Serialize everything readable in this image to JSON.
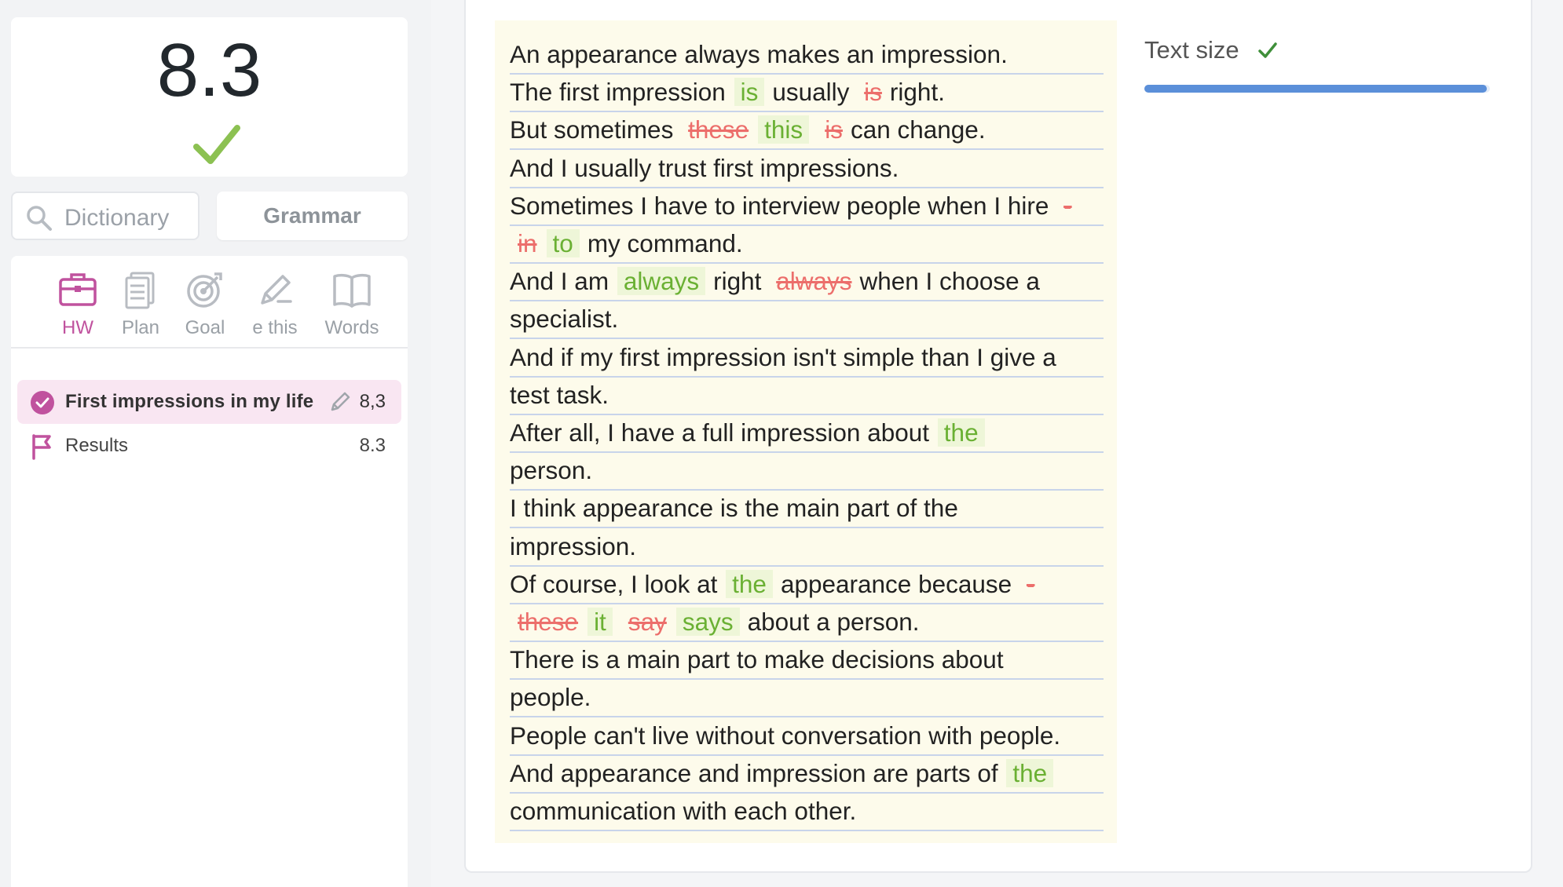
{
  "score": {
    "value": "8.3"
  },
  "search": {
    "dictionary_label": "Dictionary",
    "grammar_label": "Grammar"
  },
  "tabs": [
    {
      "label": "HW",
      "icon": "briefcase-icon",
      "active": true
    },
    {
      "label": "Plan",
      "icon": "document-icon",
      "active": false
    },
    {
      "label": "Goal",
      "icon": "target-icon",
      "active": false
    },
    {
      "label": "e this",
      "icon": "pencil-icon",
      "active": false
    },
    {
      "label": "Words",
      "icon": "book-icon",
      "active": false
    }
  ],
  "lessons": [
    {
      "title": "First impressions in my life",
      "score": "8,3",
      "active": true,
      "icon": "check-circle-icon"
    },
    {
      "title": "Results",
      "score": "8.3",
      "active": false,
      "icon": "flag-icon"
    }
  ],
  "essay": {
    "lines": [
      [
        {
          "t": "n",
          "v": "An appearance always makes an impression."
        }
      ],
      [
        {
          "t": "n",
          "v": "The first impression"
        },
        {
          "t": "ins",
          "v": "is"
        },
        {
          "t": "n",
          "v": "usually"
        },
        {
          "t": "del",
          "v": "is"
        },
        {
          "t": "n",
          "v": "right."
        }
      ],
      [
        {
          "t": "n",
          "v": "But sometimes"
        },
        {
          "t": "del",
          "v": "these"
        },
        {
          "t": "ins",
          "v": "this"
        },
        {
          "t": "del",
          "v": "is"
        },
        {
          "t": "n",
          "v": "can change."
        }
      ],
      [
        {
          "t": "n",
          "v": "And I usually trust first impressions."
        }
      ],
      [
        {
          "t": "n",
          "v": "Sometimes I have to interview people when I hire"
        },
        {
          "t": "del",
          "v": "-"
        }
      ],
      [
        {
          "t": "del",
          "v": "in"
        },
        {
          "t": "ins",
          "v": "to"
        },
        {
          "t": "n",
          "v": "my command."
        }
      ],
      [
        {
          "t": "n",
          "v": "And I am"
        },
        {
          "t": "ins",
          "v": "always"
        },
        {
          "t": "n",
          "v": "right"
        },
        {
          "t": "del",
          "v": "always"
        },
        {
          "t": "n",
          "v": "when I choose a"
        }
      ],
      [
        {
          "t": "n",
          "v": "specialist."
        }
      ],
      [
        {
          "t": "n",
          "v": "And if my first impression isn't simple than I give a"
        }
      ],
      [
        {
          "t": "n",
          "v": "test task."
        }
      ],
      [
        {
          "t": "n",
          "v": "After all, I have a full impression about"
        },
        {
          "t": "ins",
          "v": "the"
        }
      ],
      [
        {
          "t": "n",
          "v": "person."
        }
      ],
      [
        {
          "t": "n",
          "v": "I think appearance is the main part of the"
        }
      ],
      [
        {
          "t": "n",
          "v": "impression."
        }
      ],
      [
        {
          "t": "n",
          "v": "Of course, I look at"
        },
        {
          "t": "ins",
          "v": "the"
        },
        {
          "t": "n",
          "v": "appearance because"
        },
        {
          "t": "del",
          "v": "-"
        }
      ],
      [
        {
          "t": "del",
          "v": "these"
        },
        {
          "t": "ins",
          "v": "it"
        },
        {
          "t": "del",
          "v": "say"
        },
        {
          "t": "ins",
          "v": "says"
        },
        {
          "t": "n",
          "v": "about a person."
        }
      ],
      [
        {
          "t": "n",
          "v": "There is a main part to make decisions about"
        }
      ],
      [
        {
          "t": "n",
          "v": "people."
        }
      ],
      [
        {
          "t": "n",
          "v": "People can't live without conversation with people."
        }
      ],
      [
        {
          "t": "n",
          "v": "And appearance and impression are parts of"
        },
        {
          "t": "ins",
          "v": "the"
        }
      ],
      [
        {
          "t": "n",
          "v": "communication with each other."
        }
      ]
    ]
  },
  "sidebar": {
    "text_size_label": "Text size",
    "text_size_value": 1.0
  },
  "colors": {
    "accent": "#c0529e",
    "insert": "#6ab033",
    "delete": "#ec6e6b",
    "slider": "#5b8fd9",
    "check": "#8cc152"
  }
}
